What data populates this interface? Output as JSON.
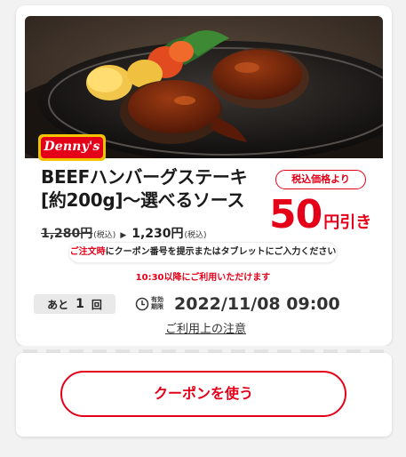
{
  "brand": {
    "logo_text": "Denny's"
  },
  "coupon": {
    "title_line1": "BEEFハンバーグステーキ",
    "title_line2": "[約200g]〜選べるソース",
    "price_old": "1,280円",
    "price_old_tax": "(税込)",
    "price_new": "1,230円",
    "price_new_tax": "(税込)",
    "badge": "税込価格より",
    "discount_value": "50",
    "discount_unit": "円引き",
    "notice_red": "ご注文時",
    "notice_rest": "にクーポン番号を提示またはタブレットにご入力ください",
    "time_note": "10:30以降にご利用いただけます",
    "remaining_prefix": "あと",
    "remaining_count": "1",
    "remaining_suffix": "回",
    "expiry_label": "有効期限",
    "expiry_date": "2022/11/08 09:00",
    "terms_link": "ご利用上の注意",
    "use_button": "クーポンを使う"
  },
  "colors": {
    "accent": "#e50019",
    "background": "#f2f2f2",
    "card": "#ffffff"
  },
  "icons": {
    "clock": "clock-icon",
    "arrow": "triangle-right-icon"
  }
}
